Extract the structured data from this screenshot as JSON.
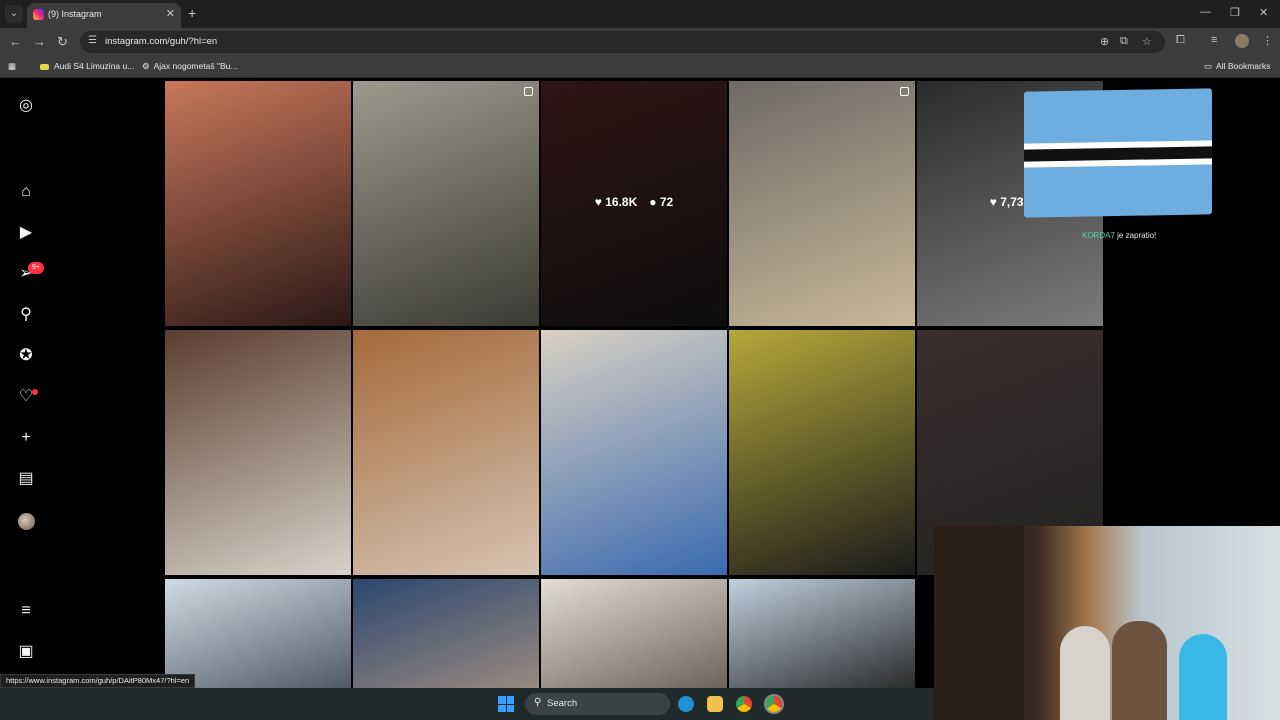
{
  "browser": {
    "tab_title": "(9) Instagram",
    "url": "instagram.com/guh/?hl=en",
    "bookmarks": [
      "Audi S4 Limuzina u...",
      "Ajax nogometaš \"Bu...",
      "All Bookmarks"
    ]
  },
  "instagram": {
    "notifications_badge": "9+",
    "posts": [
      {
        "colors": [
          "#c9775a",
          "#2a1816"
        ]
      },
      {
        "colors": [
          "#9c9a8c",
          "#3b3a34"
        ],
        "has_multi": true
      },
      {
        "colors": [
          "#4a2020",
          "#151515"
        ],
        "likes": "16.8K",
        "comments": "72",
        "hover": true
      },
      {
        "colors": [
          "#6d6a64",
          "#c9b79a"
        ],
        "has_multi": true
      },
      {
        "colors": [
          "#424242",
          "#bdbdbd"
        ],
        "likes": "7,739",
        "hover": true
      },
      {
        "colors": [
          "#5a3e30",
          "#d9d2c8"
        ]
      },
      {
        "colors": [
          "#a46a3a",
          "#d6c3b2"
        ]
      },
      {
        "colors": [
          "#d9d1c4",
          "#3a6ab0"
        ]
      },
      {
        "colors": [
          "#b5a83a",
          "#1a1a1a"
        ]
      },
      {
        "colors": [
          "#3a2e2e",
          "#222222"
        ]
      },
      {
        "colors": [
          "#d0dbe5",
          "#4d5a66"
        ]
      },
      {
        "colors": [
          "#2b4770",
          "#9a8a80"
        ]
      },
      {
        "colors": [
          "#e4ddd5",
          "#6d6258"
        ]
      },
      {
        "colors": [
          "#bfd0e0",
          "#2a2a2a"
        ]
      }
    ]
  },
  "overlay": {
    "follow_user": "KORDA7",
    "follow_text": " je zapratio!"
  },
  "status_bar": {
    "link": "https://www.instagram.com/guh/p/DAitP80Mx47/?hl=en"
  },
  "taskbar": {
    "search_label": "Search"
  }
}
